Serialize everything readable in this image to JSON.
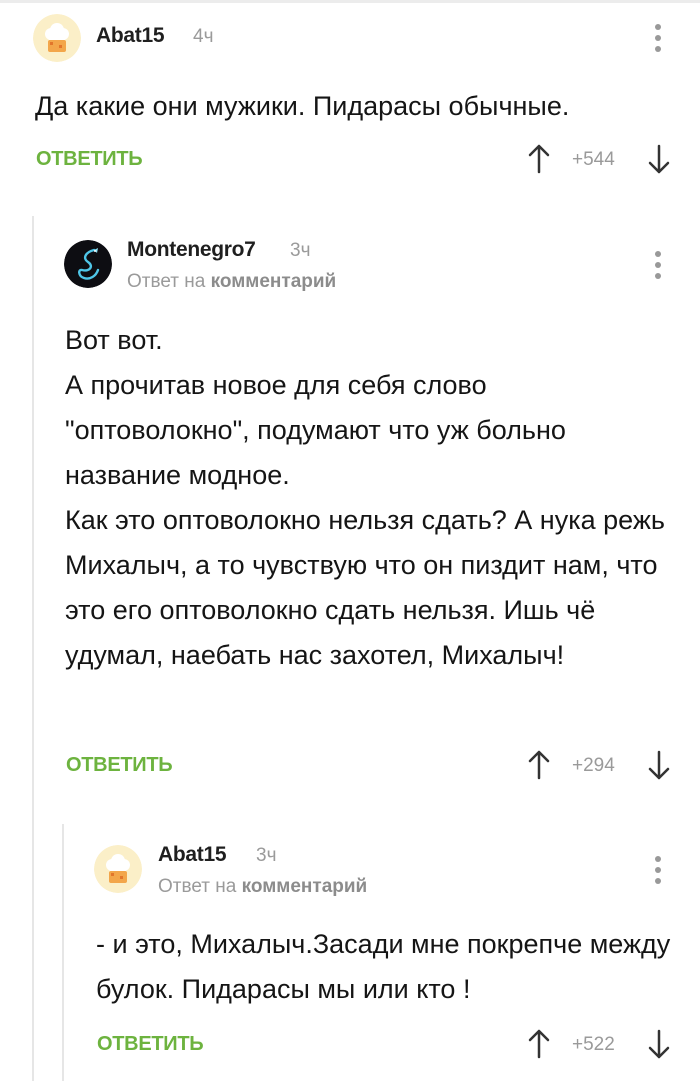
{
  "colors": {
    "accent_green": "#6db33f",
    "muted": "#9a9a9a",
    "thread_line": "#e6e6e6"
  },
  "comments": [
    {
      "username": "Abat15",
      "time": "4ч",
      "avatar_icon": "chef-hat-avatar-icon",
      "paragraphs": [
        "Да какие они мужики. Пидарасы обычные."
      ],
      "reply_label": "ОТВЕТИТЬ",
      "rating": "+544"
    },
    {
      "username": "Montenegro7",
      "time": "3ч",
      "avatar_icon": "dragon-avatar-icon",
      "reply_to_prefix": "Ответ на",
      "reply_to_link": "комментарий",
      "paragraphs": [
        "Вот вот.",
        "А прочитав новое для себя слово \"оптоволокно\", подумают что уж больно название модное.",
        "Как это оптоволокно нельзя сдать? А нука режь Михалыч, а то чувствую что он пиздит нам, что это его оптоволокно сдать нельзя. Ишь чё удумал, наебать нас захотел, Михалыч!"
      ],
      "reply_label": "ОТВЕТИТЬ",
      "rating": "+294"
    },
    {
      "username": "Abat15",
      "time": "3ч",
      "avatar_icon": "chef-hat-avatar-icon",
      "reply_to_prefix": "Ответ на",
      "reply_to_link": "комментарий",
      "paragraphs": [
        "- и это, Михалыч.Засади мне покрепче между булок. Пидарасы мы или кто !"
      ],
      "reply_label": "ОТВЕТИТЬ",
      "rating": "+522"
    }
  ]
}
